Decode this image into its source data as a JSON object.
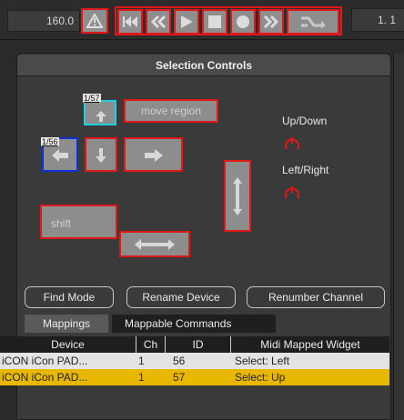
{
  "transport": {
    "tempo": "160.0",
    "time_readout": "1. 1",
    "buttons": [
      "warning",
      "rewind-to-start",
      "rewind",
      "play",
      "stop",
      "record",
      "fast-forward",
      "loop"
    ]
  },
  "panel": {
    "title": "Selection Controls"
  },
  "controls": {
    "up_badge": "1/57",
    "left_badge": "1/56",
    "move_region_label": "move region",
    "shift_label": "shift",
    "up_down_label": "Up/Down",
    "left_right_label": "Left/Right"
  },
  "buttons": {
    "find_mode": "Find Mode",
    "rename_device": "Rename Device",
    "renumber_channel": "Renumber Channel"
  },
  "tabs": {
    "mappings": "Mappings",
    "mappable_commands": "Mappable Commands"
  },
  "table": {
    "headers": [
      "Device",
      "Ch",
      "ID",
      "Midi Mapped Widget"
    ],
    "rows": [
      [
        "iCON iCon PAD...",
        "1",
        "56",
        "Select: Left"
      ],
      [
        "iCON iCon PAD...",
        "1",
        "57",
        "Select: Up"
      ]
    ],
    "selected_row": 1
  },
  "colors": {
    "highlight_border": "#e01818",
    "selected_row": "#e8b800",
    "up_badge_border": "#20d0e0",
    "left_badge_border": "#1030e0"
  }
}
